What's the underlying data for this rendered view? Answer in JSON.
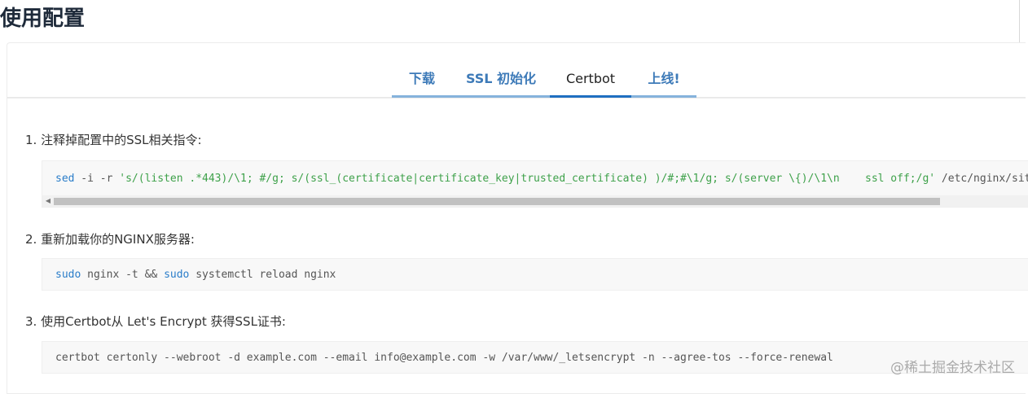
{
  "page": {
    "title": "使用配置"
  },
  "tabs": [
    {
      "label": "下载",
      "active": false
    },
    {
      "label": "SSL 初始化",
      "active": false
    },
    {
      "label": "Certbot",
      "active": true
    },
    {
      "label": "上线!",
      "active": false
    }
  ],
  "steps": [
    {
      "label": "1. 注释掉配置中的SSL相关指令:",
      "code": {
        "cmd": "sed",
        "opts": " -i -r ",
        "str1": "'s/(listen .*443)/\\1; #/g; s/(ssl_(certificate|certificate_key|trusted_certificate) )/#;#\\1/g; s/(server \\{)/\\1\\n    ssl off;/g'",
        "rest": " /etc/nginx/sites-available/"
      },
      "has_scrollbar": true
    },
    {
      "label": "2. 重新加载你的NGINX服务器:",
      "code": {
        "kw1": "sudo",
        "mid": " nginx -t && ",
        "kw2": "sudo",
        "rest": " systemctl reload nginx"
      }
    },
    {
      "label": "3. 使用Certbot从 Let's Encrypt 获得SSL证书:",
      "code": {
        "text": "certbot certonly --webroot -d example.com --email info@example.com -w /var/www/_letsencrypt -n --agree-tos --force-renewal"
      }
    }
  ],
  "watermark": "@稀土掘金技术社区",
  "colors": {
    "tab_text": "#3d7ab8",
    "active_bar": "#1f6fc1",
    "keyword": "#2a7dc9",
    "string": "#3ea14a"
  },
  "icons": {
    "scroll_left": "triangle-left-icon"
  }
}
